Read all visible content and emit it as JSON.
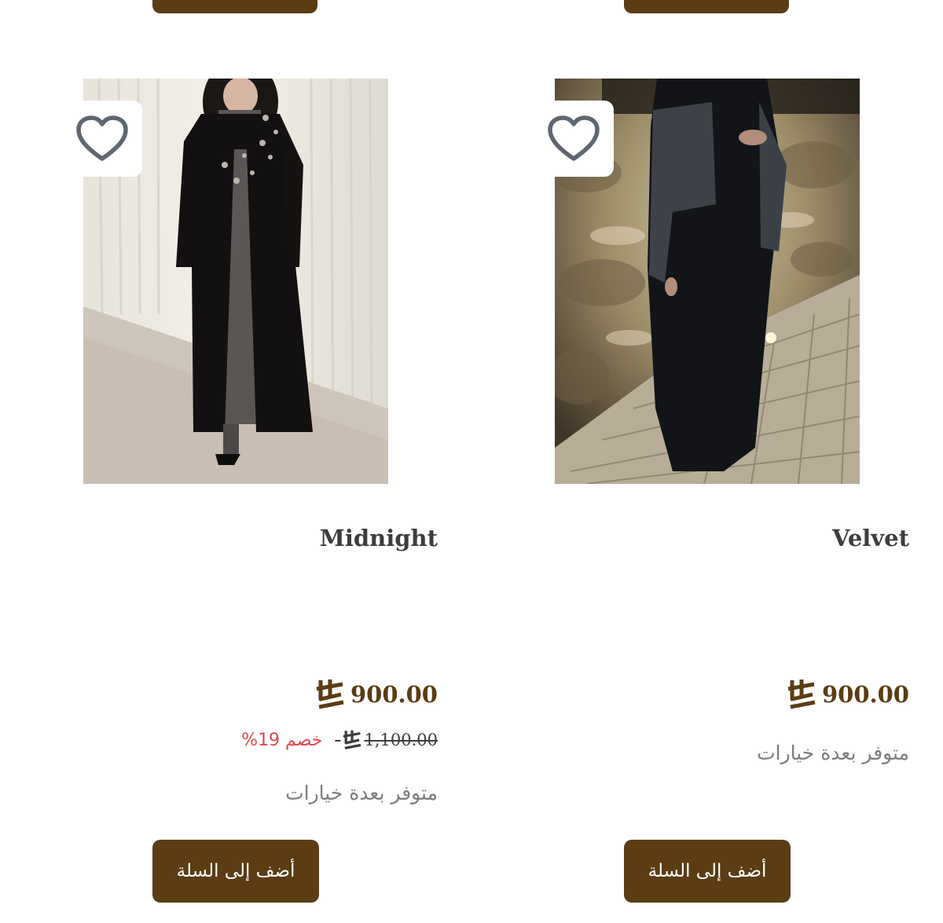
{
  "theme": {
    "brand_color": "#5b3c13",
    "discount_color": "#e0474c",
    "muted_text_color": "#7d7d7d",
    "title_color": "#3d3d3d"
  },
  "products": [
    {
      "name": "Midnight",
      "price": "900.00",
      "old_price": "1,100.00",
      "old_price_prefix": "-",
      "discount_label": "خصم 19%",
      "availability": "متوفر بعدة خيارات",
      "add_to_cart_label": "أضف إلى السلة",
      "wishlist_icon": "heart-outline-icon",
      "currency_icon": "saudi-riyal-icon"
    },
    {
      "name": "Velvet",
      "price": "900.00",
      "availability": "متوفر بعدة خيارات",
      "add_to_cart_label": "أضف إلى السلة",
      "wishlist_icon": "heart-outline-icon",
      "currency_icon": "saudi-riyal-icon"
    }
  ]
}
